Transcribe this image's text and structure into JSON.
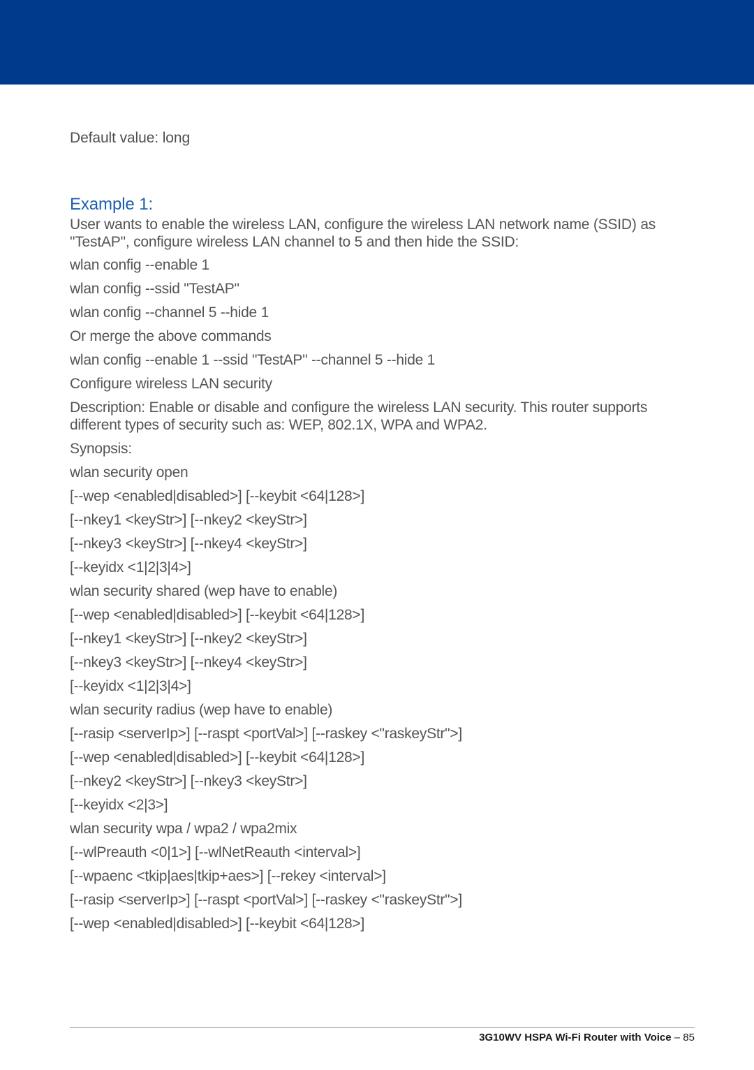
{
  "defaultValue": "Default value: long",
  "exampleHeading": "Example 1:",
  "intro": "User wants to enable the wireless LAN, configure the wireless LAN network name (SSID) as \"TestAP\", configure wireless LAN channel to 5 and then hide the SSID:",
  "lines": [
    "wlan config --enable 1",
    "wlan config --ssid \"TestAP\"",
    "wlan config --channel 5 --hide 1",
    "Or merge the above commands",
    "wlan config --enable 1 --ssid \"TestAP\" --channel 5 --hide 1",
    "Configure wireless LAN security",
    "Description: Enable or disable and configure the wireless LAN security. This router supports different types of security such as: WEP, 802.1X, WPA and WPA2.",
    "Synopsis:",
    "wlan security open",
    "[--wep <enabled|disabled>] [--keybit <64|128>]",
    "[--nkey1 <keyStr>] [--nkey2 <keyStr>]",
    "[--nkey3 <keyStr>] [--nkey4 <keyStr>]",
    "[--keyidx <1|2|3|4>]",
    "wlan security shared (wep have to enable)",
    "[--wep <enabled|disabled>] [--keybit <64|128>]",
    "[--nkey1 <keyStr>] [--nkey2 <keyStr>]",
    "[--nkey3 <keyStr>] [--nkey4 <keyStr>]",
    "[--keyidx <1|2|3|4>]",
    "wlan security radius (wep have to enable)",
    "[--rasip <serverIp>] [--raspt <portVal>] [--raskey <\"raskeyStr\">]",
    "[--wep <enabled|disabled>] [--keybit <64|128>]",
    "[--nkey2 <keyStr>] [--nkey3 <keyStr>]",
    "[--keyidx <2|3>]",
    "wlan security wpa / wpa2 / wpa2mix",
    "[--wlPreauth <0|1>] [--wlNetReauth <interval>]",
    "[--wpaenc <tkip|aes|tkip+aes>] [--rekey <interval>]",
    "[--rasip <serverIp>] [--raspt <portVal>] [--raskey <\"raskeyStr\">]",
    "[--wep <enabled|disabled>] [--keybit <64|128>]"
  ],
  "footer": {
    "bold": "3G10WV HSPA Wi-Fi Router with Voice",
    "rest": " – 85"
  }
}
